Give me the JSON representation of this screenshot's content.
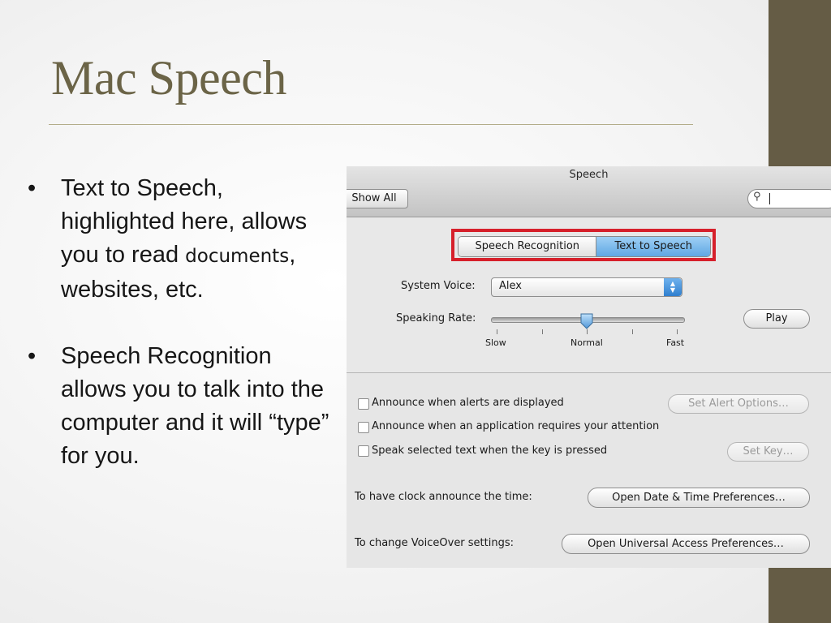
{
  "slide": {
    "title": "Mac Speech",
    "bullets": [
      {
        "marker": "•",
        "text_a": "Text to Speech, highlighted here, allows you to read ",
        "text_b": "documents",
        "text_c": ", websites, etc."
      },
      {
        "marker": "•",
        "text_a": "Speech Recognition allows you to talk into the computer and it will ",
        "text_b": "“type”",
        "text_c": " for you."
      }
    ],
    "colors": {
      "accent_bar": "#655c45",
      "title": "#6b6447",
      "highlight_box": "#d6202b"
    }
  },
  "window": {
    "title": "Speech",
    "show_all_label": "Show All",
    "search": {
      "icon": "magnifier-icon",
      "value": ""
    },
    "tabs": [
      {
        "label": "Speech Recognition",
        "selected": false
      },
      {
        "label": "Text to Speech",
        "selected": true
      }
    ],
    "system_voice": {
      "label": "System Voice:",
      "value": "Alex"
    },
    "speaking_rate": {
      "label": "Speaking Rate:",
      "min_label": "Slow",
      "mid_label": "Normal",
      "max_label": "Fast",
      "level": 0.5
    },
    "play_label": "Play",
    "options": [
      {
        "label": "Announce when alerts are displayed",
        "checked": false,
        "button": "Set Alert Options…",
        "button_enabled": false
      },
      {
        "label": "Announce when an application requires your attention",
        "checked": false
      },
      {
        "label": "Speak selected text when the key is pressed",
        "checked": false,
        "button": "Set Key…",
        "button_enabled": false
      }
    ],
    "clock": {
      "label": "To have clock announce the time:",
      "button": "Open Date & Time Preferences…"
    },
    "voiceover": {
      "label": "To change VoiceOver settings:",
      "button": "Open Universal Access Preferences…"
    }
  }
}
